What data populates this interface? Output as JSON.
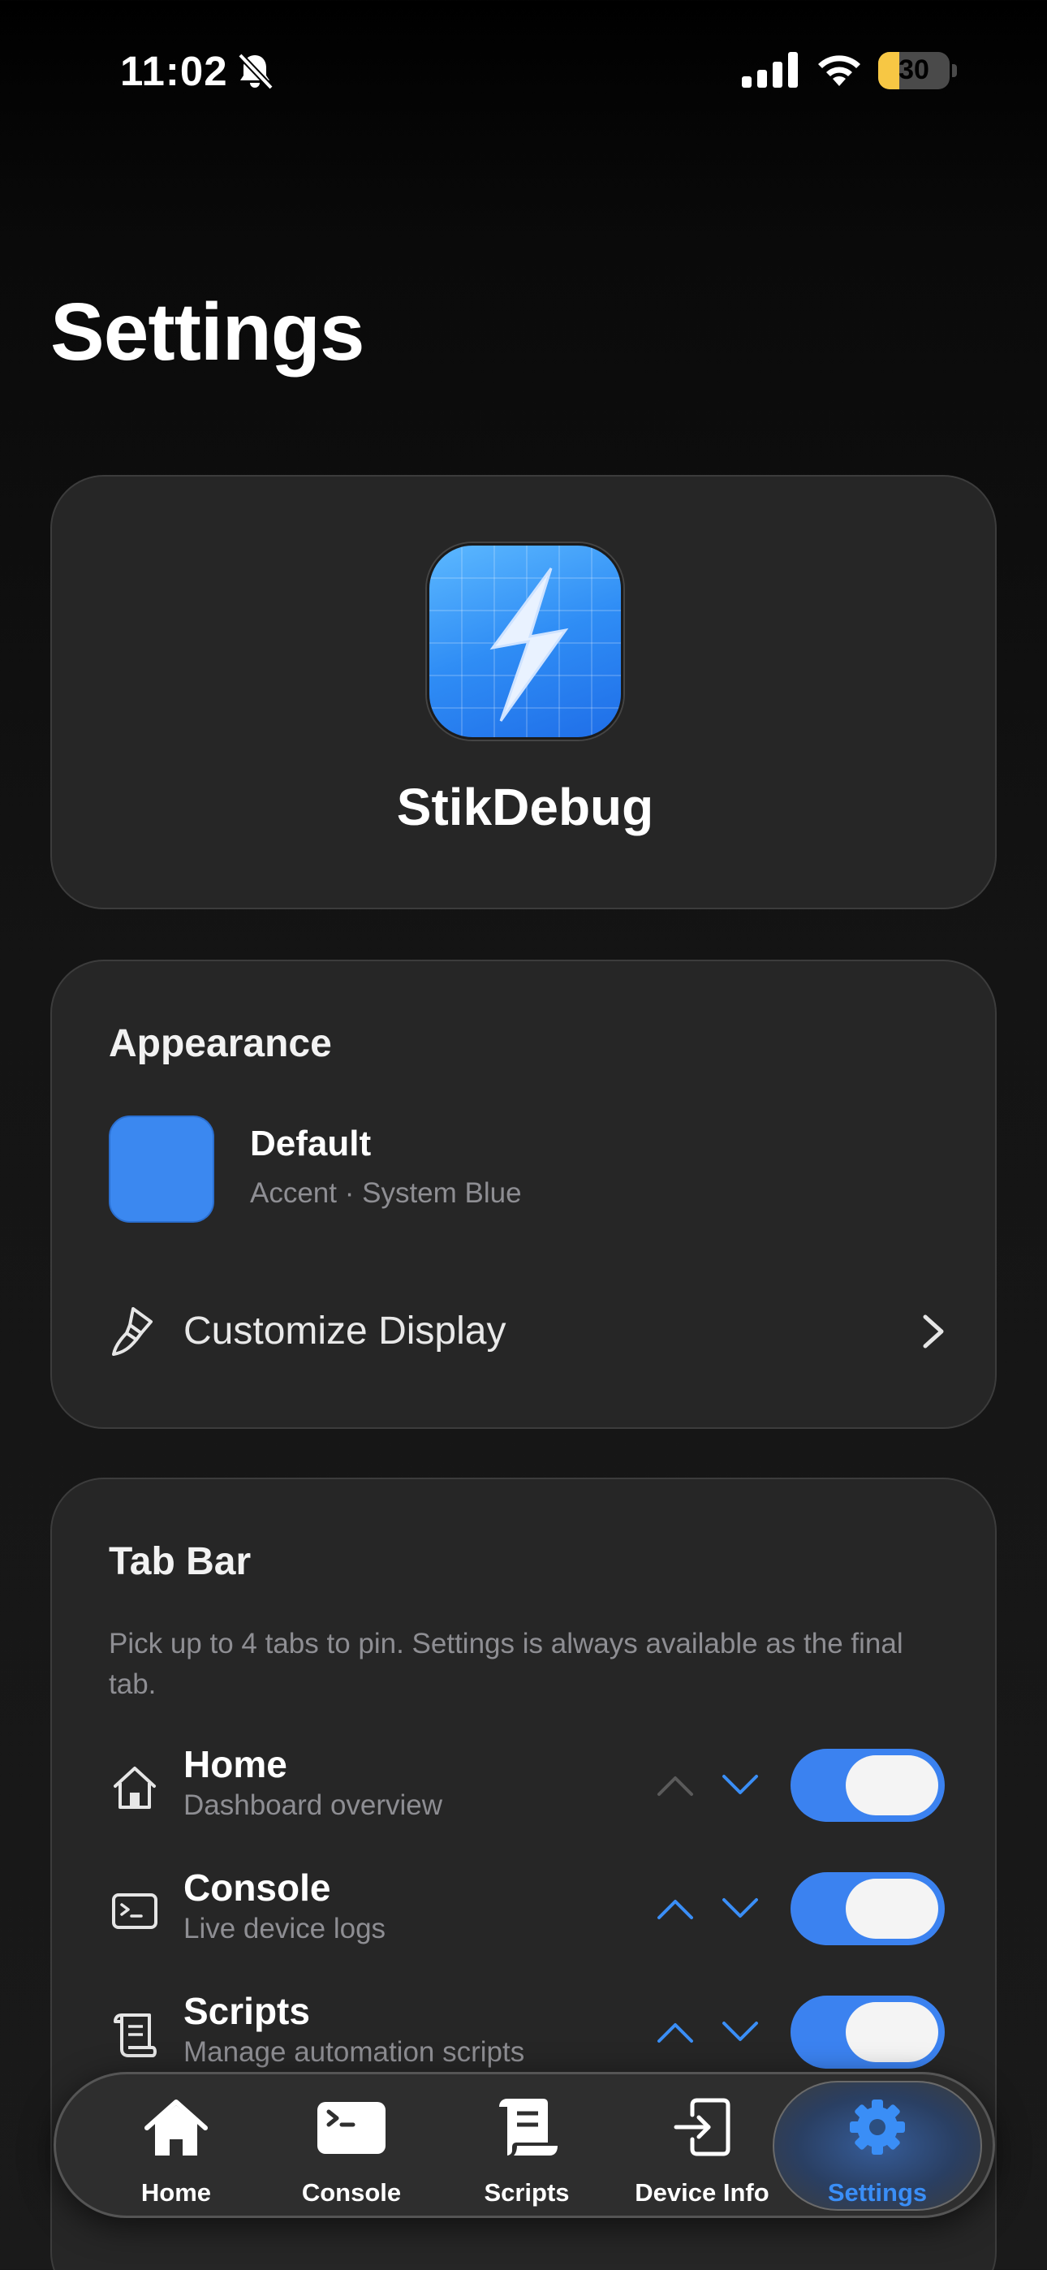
{
  "status_bar": {
    "time": "11:02",
    "battery": "30",
    "battery_level": 0.3
  },
  "page": {
    "title": "Settings"
  },
  "app": {
    "name": "StikDebug"
  },
  "appearance": {
    "title": "Appearance",
    "theme_name": "Default",
    "theme_detail": "Accent · System Blue",
    "accent_color": "#3b88f0",
    "customize_label": "Customize Display"
  },
  "tab_settings": {
    "title": "Tab Bar",
    "description": "Pick up to 4 tabs to pin. Settings is always available as the final tab.",
    "rows": [
      {
        "title": "Home",
        "subtitle": "Dashboard overview",
        "icon": "house-icon",
        "enabled": true,
        "can_move_up": false,
        "can_move_down": true
      },
      {
        "title": "Console",
        "subtitle": "Live device logs",
        "icon": "terminal-icon",
        "enabled": true,
        "can_move_up": true,
        "can_move_down": true
      },
      {
        "title": "Scripts",
        "subtitle": "Manage automation scripts",
        "icon": "scroll-icon",
        "enabled": true,
        "can_move_up": true,
        "can_move_down": true
      }
    ]
  },
  "tab_bar": {
    "items": [
      {
        "label": "Home",
        "icon": "house-fill-icon"
      },
      {
        "label": "Console",
        "icon": "terminal-fill-icon"
      },
      {
        "label": "Scripts",
        "icon": "scroll-fill-icon"
      },
      {
        "label": "Device Info",
        "icon": "arrow-into-door-icon"
      },
      {
        "label": "Settings",
        "icon": "gear-icon"
      }
    ],
    "active": "Settings"
  },
  "colors": {
    "accent": "#3a8ef6",
    "background": "#000000",
    "card": "#262626",
    "secondary_text": "#8e8e93"
  }
}
